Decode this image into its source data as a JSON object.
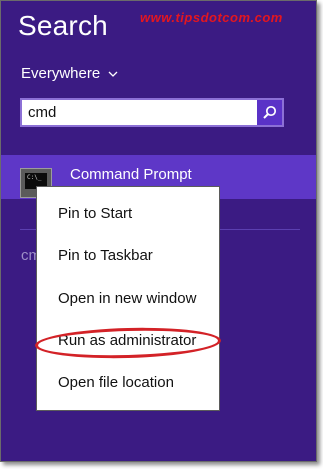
{
  "header": {
    "title": "Search",
    "watermark": "www.tipsdotcom.com"
  },
  "scope": {
    "label": "Everywhere"
  },
  "search": {
    "value": "cmd"
  },
  "result": {
    "label": "Command Prompt",
    "icon": "command-prompt-icon"
  },
  "background_text": "cm",
  "context_menu": {
    "items": [
      "Pin to Start",
      "Pin to Taskbar",
      "Open in new window",
      "Run as administrator",
      "Open file location"
    ],
    "highlighted": "Run as administrator"
  },
  "colors": {
    "background": "#3b1b83",
    "result_highlight": "#5e37c7",
    "search_button": "#5a32c7",
    "watermark": "#e4161f",
    "annotation_ring": "#d32227"
  }
}
